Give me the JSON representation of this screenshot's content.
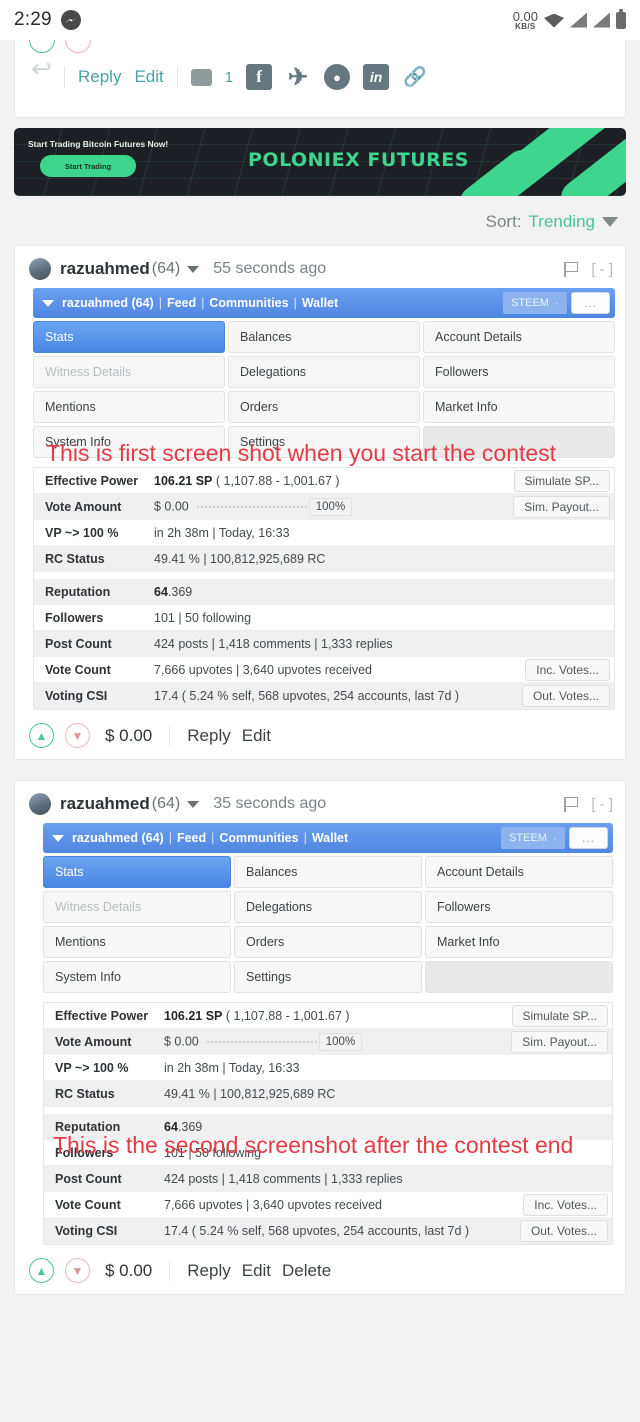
{
  "statusbar": {
    "clock": "2:29",
    "messenger_icon": "messenger-icon",
    "network_speed": "0.00",
    "network_speed_unit": "KB/S",
    "wifi_icon": "wifi-icon",
    "signal_icon": "signal-icon",
    "battery_icon": "battery-icon"
  },
  "top_post_footer": {
    "resteem_icon": "resteem-icon",
    "reply_label": "Reply",
    "edit_label": "Edit",
    "comment_icon": "comment-icon",
    "comment_count": "1",
    "share": [
      {
        "name": "facebook-icon",
        "glyph": "f"
      },
      {
        "name": "twitter-icon",
        "glyph": "✈"
      },
      {
        "name": "reddit-icon",
        "glyph": "●"
      },
      {
        "name": "linkedin-icon",
        "glyph": "in"
      },
      {
        "name": "link-icon",
        "glyph": "🔗"
      }
    ]
  },
  "banner": {
    "headline": "Start Trading Bitcoin Futures Now!",
    "cta": "Start Trading",
    "title": "POLONIEX FUTURES",
    "bg_color": "#1c1f24",
    "accent_color": "#3ed68f"
  },
  "sort": {
    "label": "Sort:",
    "value": "Trending",
    "caret_icon": "chevron-down-icon"
  },
  "comments": [
    {
      "author": "razuahmed",
      "reputation": "(64)",
      "timestamp": "55 seconds ago",
      "flag_icon": "flag-icon",
      "collapse_label": "[ - ]",
      "screenshot": {
        "nav": {
          "user": "razuahmed (64)",
          "items": [
            "Feed",
            "Communities",
            "Wallet"
          ],
          "token": "STEEM",
          "token_caret": "·",
          "more_label": "..."
        },
        "tiles": [
          {
            "label": "Stats",
            "state": "active"
          },
          {
            "label": "Balances",
            "state": "normal"
          },
          {
            "label": "Account Details",
            "state": "normal"
          },
          {
            "label": "Witness Details",
            "state": "muted"
          },
          {
            "label": "Delegations",
            "state": "normal"
          },
          {
            "label": "Followers",
            "state": "normal"
          },
          {
            "label": "Mentions",
            "state": "normal"
          },
          {
            "label": "Orders",
            "state": "normal"
          },
          {
            "label": "Market Info",
            "state": "normal"
          },
          {
            "label": "System Info",
            "state": "normal"
          },
          {
            "label": "Settings",
            "state": "normal"
          },
          {
            "label": "",
            "state": "empty"
          }
        ],
        "stats": [
          {
            "key": "Effective Power",
            "value_bold": "106.21 SP",
            "value": " ( 1,107.88 - 1,001.67 )",
            "button": "Simulate SP...",
            "alt": false
          },
          {
            "key": "Vote Amount",
            "value_bold": "",
            "value": "$ 0.00",
            "slider_pct": "100%",
            "button": "Sim. Payout...",
            "alt": true
          },
          {
            "key": "VP ~> 100 %",
            "value_bold": "",
            "value": "in 2h 38m | Today, 16:33",
            "button": "",
            "alt": false
          },
          {
            "key": "RC Status",
            "value_bold": "",
            "value": "49.41 % | 100,812,925,689 RC",
            "button": "",
            "alt": true
          },
          {
            "key": "Reputation",
            "value_bold": "64",
            "value": ".369",
            "button": "",
            "alt": true
          },
          {
            "key": "Followers",
            "value_bold": "",
            "value": "101 | 50 following",
            "button": "",
            "alt": false
          },
          {
            "key": "Post Count",
            "value_bold": "",
            "value": "424 posts | 1,418 comments | 1,333 replies",
            "button": "",
            "alt": true
          },
          {
            "key": "Vote Count",
            "value_bold": "",
            "value": "7,666 upvotes | 3,640 upvotes received",
            "button": "Inc. Votes...",
            "alt": false
          },
          {
            "key": "Voting CSI",
            "value_bold": "",
            "value": "17.4 ( 5.24 % self, 568 upvotes, 254 accounts, last 7d )",
            "button": "Out. Votes...",
            "alt": true
          }
        ]
      },
      "footer": {
        "upvote_icon": "upvote-icon",
        "downvote_icon": "downvote-icon",
        "payout": "$ 0.00",
        "links": [
          "Reply",
          "Edit"
        ]
      }
    },
    {
      "author": "razuahmed",
      "reputation": "(64)",
      "timestamp": "35 seconds ago",
      "flag_icon": "flag-icon",
      "collapse_label": "[ - ]",
      "screenshot": {
        "nav": {
          "user": "razuahmed (64)",
          "items": [
            "Feed",
            "Communities",
            "Wallet"
          ],
          "token": "STEEM",
          "token_caret": "·",
          "more_label": "..."
        },
        "tiles": [
          {
            "label": "Stats",
            "state": "active"
          },
          {
            "label": "Balances",
            "state": "normal"
          },
          {
            "label": "Account Details",
            "state": "normal"
          },
          {
            "label": "Witness Details",
            "state": "muted"
          },
          {
            "label": "Delegations",
            "state": "normal"
          },
          {
            "label": "Followers",
            "state": "normal"
          },
          {
            "label": "Mentions",
            "state": "normal"
          },
          {
            "label": "Orders",
            "state": "normal"
          },
          {
            "label": "Market Info",
            "state": "normal"
          },
          {
            "label": "System Info",
            "state": "normal"
          },
          {
            "label": "Settings",
            "state": "normal"
          },
          {
            "label": "",
            "state": "empty"
          }
        ],
        "stats": [
          {
            "key": "Effective Power",
            "value_bold": "106.21 SP",
            "value": " ( 1,107.88 - 1,001.67 )",
            "button": "Simulate SP...",
            "alt": false
          },
          {
            "key": "Vote Amount",
            "value_bold": "",
            "value": "$ 0.00",
            "slider_pct": "100%",
            "button": "Sim. Payout...",
            "alt": true
          },
          {
            "key": "VP ~> 100 %",
            "value_bold": "",
            "value": "in 2h 38m | Today, 16:33",
            "button": "",
            "alt": false
          },
          {
            "key": "RC Status",
            "value_bold": "",
            "value": "49.41 % | 100,812,925,689 RC",
            "button": "",
            "alt": true
          },
          {
            "key": "Reputation",
            "value_bold": "64",
            "value": ".369",
            "button": "",
            "alt": true
          },
          {
            "key": "Followers",
            "value_bold": "",
            "value": "101 | 50 following",
            "button": "",
            "alt": false
          },
          {
            "key": "Post Count",
            "value_bold": "",
            "value": "424 posts | 1,418 comments | 1,333 replies",
            "button": "",
            "alt": true
          },
          {
            "key": "Vote Count",
            "value_bold": "",
            "value": "7,666 upvotes | 3,640 upvotes received",
            "button": "Inc. Votes...",
            "alt": false
          },
          {
            "key": "Voting CSI",
            "value_bold": "",
            "value": "17.4 ( 5.24 % self, 568 upvotes, 254 accounts, last 7d )",
            "button": "Out. Votes...",
            "alt": true
          }
        ]
      },
      "footer": {
        "upvote_icon": "upvote-icon",
        "downvote_icon": "downvote-icon",
        "payout": "$ 0.00",
        "links": [
          "Reply",
          "Edit",
          "Delete"
        ]
      }
    }
  ],
  "annotations": [
    {
      "text": "This is first screen shot when you start the contest",
      "color": "#e33b43"
    },
    {
      "text": "This is the second screenshot after the contest end",
      "color": "#e33b43"
    }
  ]
}
